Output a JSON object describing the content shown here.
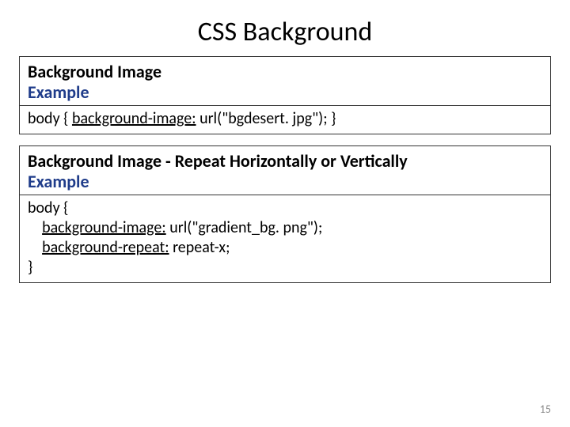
{
  "title": "CSS Background",
  "box1": {
    "heading": "Background Image",
    "exampleLabel": "Example",
    "code": {
      "pre": "body { ",
      "prop": "background-image:",
      "post": " url(\"bgdesert. jpg\"); }"
    }
  },
  "box2": {
    "heading": "Background Image - Repeat Horizontally or Vertically",
    "exampleLabel": "Example",
    "code": {
      "open": "body {",
      "indent": "    ",
      "prop1": "background-image:",
      "post1": " url(\"gradient_bg. png\");",
      "prop2": "background-repeat:",
      "post2": " repeat-x;",
      "close": "}"
    }
  },
  "pageNumber": "15"
}
